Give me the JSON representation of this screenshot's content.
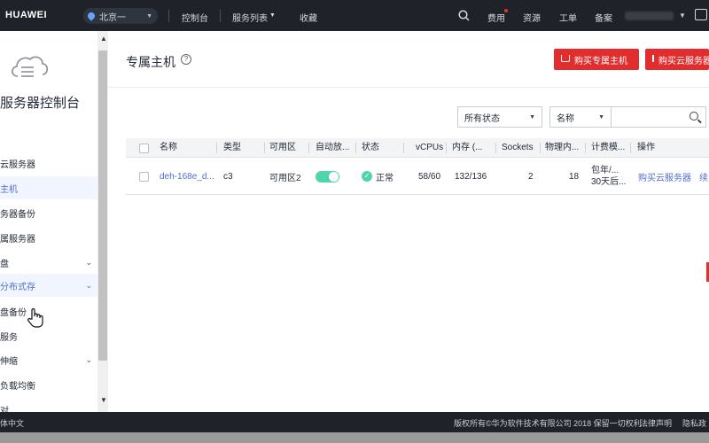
{
  "topbar": {
    "logo": "HUAWEI",
    "region": "北京一",
    "nav": [
      "控制台",
      "服务列表",
      "收藏"
    ],
    "right": [
      "费用",
      "资源",
      "工单",
      "备案"
    ]
  },
  "sidebar": {
    "title": "服务器控制台",
    "items": [
      {
        "label": "云服务器"
      },
      {
        "label": "主机"
      },
      {
        "label": "务器备份"
      },
      {
        "label": "属服务器"
      },
      {
        "label": "盘"
      },
      {
        "label": "分布式存"
      },
      {
        "label": "盘备份"
      },
      {
        "label": "服务"
      },
      {
        "label": "伸缩"
      },
      {
        "label": "负载均衡"
      },
      {
        "label": "对"
      }
    ]
  },
  "main": {
    "title": "专属主机",
    "help": "?",
    "buttons": [
      "购买专属主机",
      "购买云服务器"
    ],
    "filters": {
      "status": "所有状态",
      "field": "名称"
    },
    "table": {
      "headers": [
        "名称",
        "类型",
        "可用区",
        "自动放...",
        "状态",
        "vCPUs",
        "内存 (...",
        "Sockets",
        "物理内...",
        "计费模...",
        "操作"
      ],
      "rows": [
        {
          "name": "deh-168e_d...",
          "type": "c3",
          "zone": "可用区2",
          "status": "正常",
          "vcpus": "58/60",
          "memory": "132/136",
          "sockets": "2",
          "physical": "18",
          "billing_1": "包年/...",
          "billing_2": "30天后...",
          "action_1": "购买云服务器",
          "action_2": "续"
        }
      ]
    }
  },
  "footer": {
    "lang": "体中文",
    "copyright": "版权所有©华为软件技术有限公司 2018 保留一切权利",
    "links": [
      "法律声明",
      "隐私政"
    ]
  }
}
